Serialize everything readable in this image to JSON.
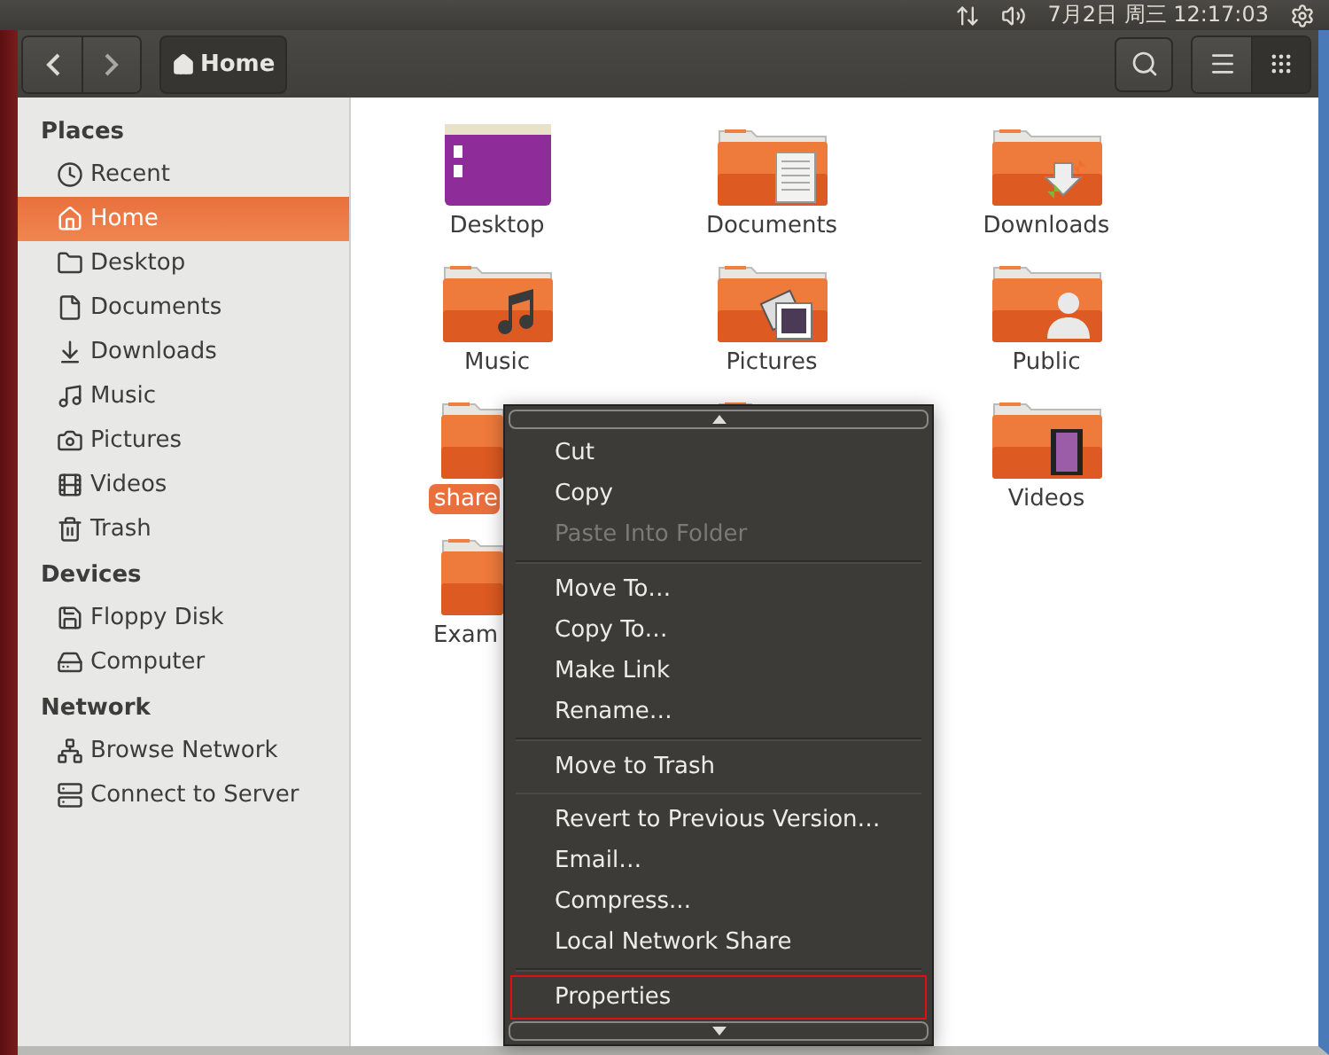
{
  "top_bar": {
    "clock": "7月2日 周三 12:17:03"
  },
  "toolbar": {
    "location": "Home",
    "view_modes": [
      {
        "kind": "list",
        "selected": false
      },
      {
        "kind": "grid",
        "selected": true
      }
    ]
  },
  "sidebar": [
    {
      "heading": "Places",
      "items": [
        {
          "label": "Recent",
          "kind": "recent",
          "selected": false
        },
        {
          "label": "Home",
          "kind": "home",
          "selected": true
        },
        {
          "label": "Desktop",
          "kind": "folder",
          "selected": false
        },
        {
          "label": "Documents",
          "kind": "document",
          "selected": false
        },
        {
          "label": "Downloads",
          "kind": "download",
          "selected": false
        },
        {
          "label": "Music",
          "kind": "music",
          "selected": false
        },
        {
          "label": "Pictures",
          "kind": "camera",
          "selected": false
        },
        {
          "label": "Videos",
          "kind": "film",
          "selected": false
        },
        {
          "label": "Trash",
          "kind": "trash",
          "selected": false
        }
      ]
    },
    {
      "heading": "Devices",
      "items": [
        {
          "label": "Floppy Disk",
          "kind": "floppy",
          "selected": false
        },
        {
          "label": "Computer",
          "kind": "disk",
          "selected": false
        }
      ]
    },
    {
      "heading": "Network",
      "items": [
        {
          "label": "Browse Network",
          "kind": "network",
          "selected": false
        },
        {
          "label": "Connect to Server",
          "kind": "server",
          "selected": false
        }
      ]
    }
  ],
  "files": [
    {
      "name": "Desktop",
      "kind": "desktop",
      "selected": false,
      "partly_hidden": false
    },
    {
      "name": "Documents",
      "kind": "documents",
      "selected": false,
      "partly_hidden": false
    },
    {
      "name": "Downloads",
      "kind": "downloads",
      "selected": false,
      "partly_hidden": false
    },
    {
      "name": "Music",
      "kind": "music",
      "selected": false,
      "partly_hidden": false
    },
    {
      "name": "Pictures",
      "kind": "pictures",
      "selected": false,
      "partly_hidden": false
    },
    {
      "name": "Public",
      "kind": "public",
      "selected": false,
      "partly_hidden": false
    },
    {
      "name": "share",
      "kind": "shared",
      "selected": true,
      "partly_hidden": true
    },
    {
      "kind": "folder"
    },
    {
      "name": "Videos",
      "kind": "videos",
      "selected": false,
      "partly_hidden": false
    },
    {
      "name": "Exam",
      "kind": "folder",
      "selected": false,
      "partly_hidden": true
    }
  ],
  "context_menu": {
    "groups": [
      [
        {
          "label": "Cut",
          "disabled": false,
          "outlined": false
        },
        {
          "label": "Copy",
          "disabled": false,
          "outlined": false
        },
        {
          "label": "Paste Into Folder",
          "disabled": true,
          "outlined": false
        }
      ],
      [
        {
          "label": "Move To…",
          "disabled": false,
          "outlined": false
        },
        {
          "label": "Copy To…",
          "disabled": false,
          "outlined": false
        },
        {
          "label": "Make Link",
          "disabled": false,
          "outlined": false
        },
        {
          "label": "Rename…",
          "disabled": false,
          "outlined": false
        }
      ],
      [
        {
          "label": "Move to Trash",
          "disabled": false,
          "outlined": false
        }
      ],
      [
        {
          "label": "Revert to Previous Version…",
          "disabled": false,
          "outlined": false
        },
        {
          "label": "Email…",
          "disabled": false,
          "outlined": false
        },
        {
          "label": "Compress...",
          "disabled": false,
          "outlined": false
        },
        {
          "label": "Local Network Share",
          "disabled": false,
          "outlined": false
        }
      ],
      [
        {
          "label": "Properties",
          "disabled": false,
          "outlined": true
        }
      ]
    ]
  }
}
